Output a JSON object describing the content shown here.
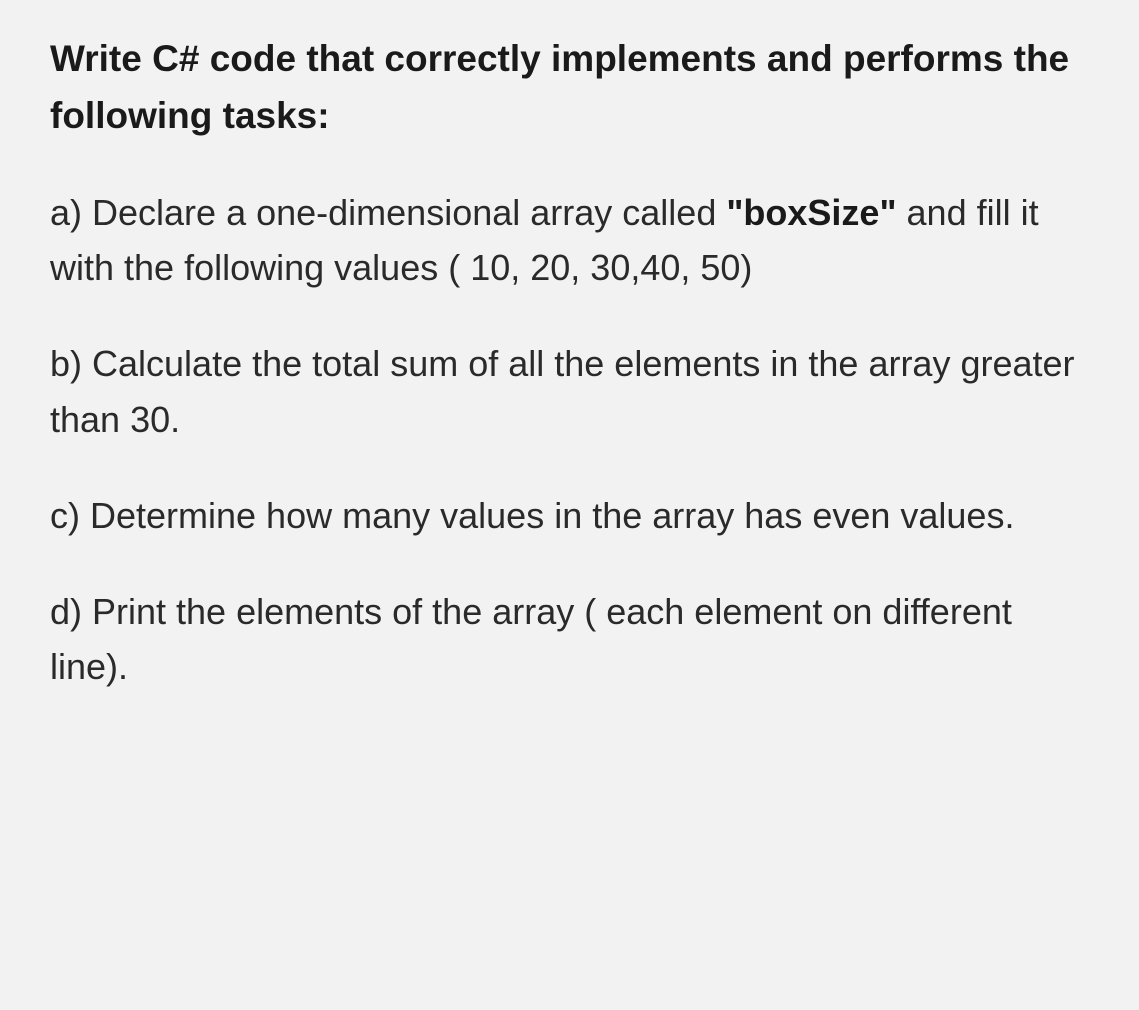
{
  "heading": "Write C# code that correctly implements and performs the following tasks:",
  "tasks": {
    "a": {
      "pre": "a) Declare a one-dimensional array called ",
      "bold": "\"boxSize\"",
      "post": " and fill it with the following values ( 10, 20, 30,40, 50)"
    },
    "b": "b) Calculate the total sum of all the elements in the array greater than 30.",
    "c": "c) Determine how many values in the array has even values.",
    "d": "d) Print the elements of the array ( each element on different line)."
  }
}
